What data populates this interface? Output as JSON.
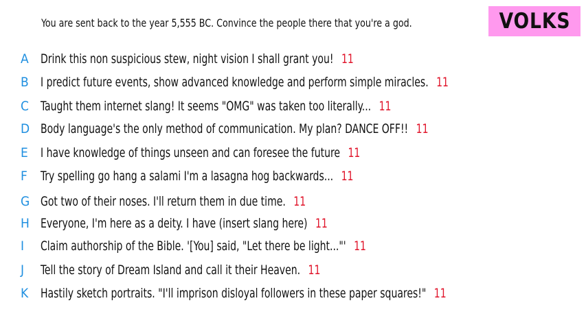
{
  "question": "You are sent back to the year 5,555 BC. Convince the people there that you're a god.",
  "badge": {
    "label": "VOLKS",
    "color": "#ff99ee"
  },
  "colors": {
    "letter": "#1f8fe0",
    "score": "#e0142a",
    "text": "#111111"
  },
  "answers": [
    {
      "letter": "A",
      "text": "Drink this non suspicious stew, night vision I shall grant you!",
      "score": "11"
    },
    {
      "letter": "B",
      "text": "I predict future events, show advanced knowledge and perform simple miracles.",
      "score": "11"
    },
    {
      "letter": "C",
      "text": "Taught them internet slang! It seems \"OMG\" was taken too literally...",
      "score": "11"
    },
    {
      "letter": "D",
      "text": "Body language's the only method of communication. My plan? DANCE OFF!!",
      "score": "11"
    },
    {
      "letter": "E",
      "text": "I have knowledge of things unseen and can foresee the future",
      "score": "11"
    },
    {
      "letter": "F",
      "text": "Try spelling go hang a salami I'm a lasagna hog backwards...",
      "score": "11"
    },
    {
      "letter": "G",
      "text": "Got two of their noses. I'll return them in due time.",
      "score": "11"
    },
    {
      "letter": "H",
      "text": "Everyone, I'm here as a deity. I have (insert slang here)",
      "score": "11"
    },
    {
      "letter": "I",
      "text": "Claim authorship of the Bible. '[You] said, \"Let there be light...\"'",
      "score": "11"
    },
    {
      "letter": "J",
      "text": "Tell the story of Dream Island and call it their Heaven.",
      "score": "11"
    },
    {
      "letter": "K",
      "text": "Hastily sketch portraits. \"I'll imprison disloyal followers in these paper squares!\"",
      "score": "11"
    }
  ]
}
